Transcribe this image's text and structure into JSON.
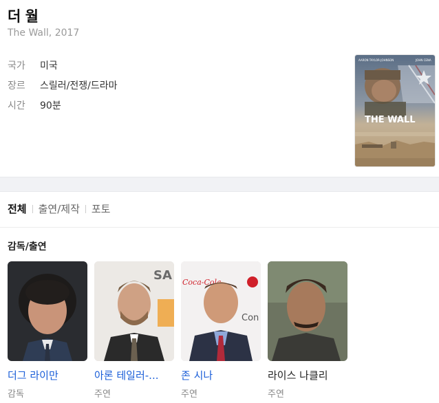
{
  "movie": {
    "title": "더 월",
    "subtitle": "The Wall, 2017",
    "info": [
      {
        "key": "국가",
        "value": "미국"
      },
      {
        "key": "장르",
        "value": "스릴러/전쟁/드라마"
      },
      {
        "key": "시간",
        "value": "90분"
      }
    ],
    "poster": {
      "top_left": "AARON TAYLOR-JOHNSON",
      "top_right": "JOHN CENA",
      "title": "THE WALL"
    }
  },
  "tabs": [
    {
      "label": "전체",
      "active": true
    },
    {
      "label": "출연/제작",
      "active": false
    },
    {
      "label": "포토",
      "active": false
    }
  ],
  "cast_section": {
    "title": "감독/출연",
    "people": [
      {
        "name": "더그 라이만",
        "role": "감독",
        "linked": true
      },
      {
        "name": "아론 테일러-...",
        "role": "주연",
        "linked": true
      },
      {
        "name": "존 시나",
        "role": "주연",
        "linked": true
      },
      {
        "name": "라이스 나클리",
        "role": "주연",
        "linked": false
      }
    ]
  },
  "photo_texts": {
    "tiff_sign": "SA",
    "cola_sign": "Coca-Cola",
    "con_sign": "Con"
  }
}
